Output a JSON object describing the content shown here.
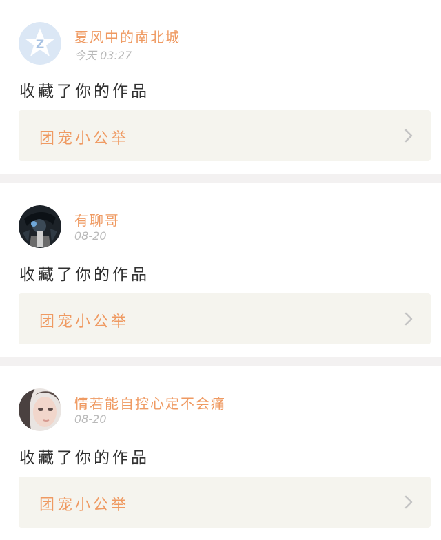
{
  "notifications": [
    {
      "user": "夏风中的南北城",
      "time": "今天 03:27",
      "action": "收藏了你的作品",
      "work_title": "团宠小公举",
      "avatar_icon": "qzone-default-avatar-icon"
    },
    {
      "user": "有聊哥",
      "time": "08-20",
      "action": "收藏了你的作品",
      "work_title": "团宠小公举",
      "avatar_icon": "dark-photo-avatar"
    },
    {
      "user": "情若能自控心定不会痛",
      "time": "08-20",
      "action": "收藏了你的作品",
      "work_title": "团宠小公举",
      "avatar_icon": "portrait-photo-avatar"
    }
  ],
  "colors": {
    "accent": "#ef9a62",
    "time": "#b9b9b9",
    "text": "#303030",
    "card_bg": "#f5f4ee",
    "separator": "#f3f1f1"
  }
}
